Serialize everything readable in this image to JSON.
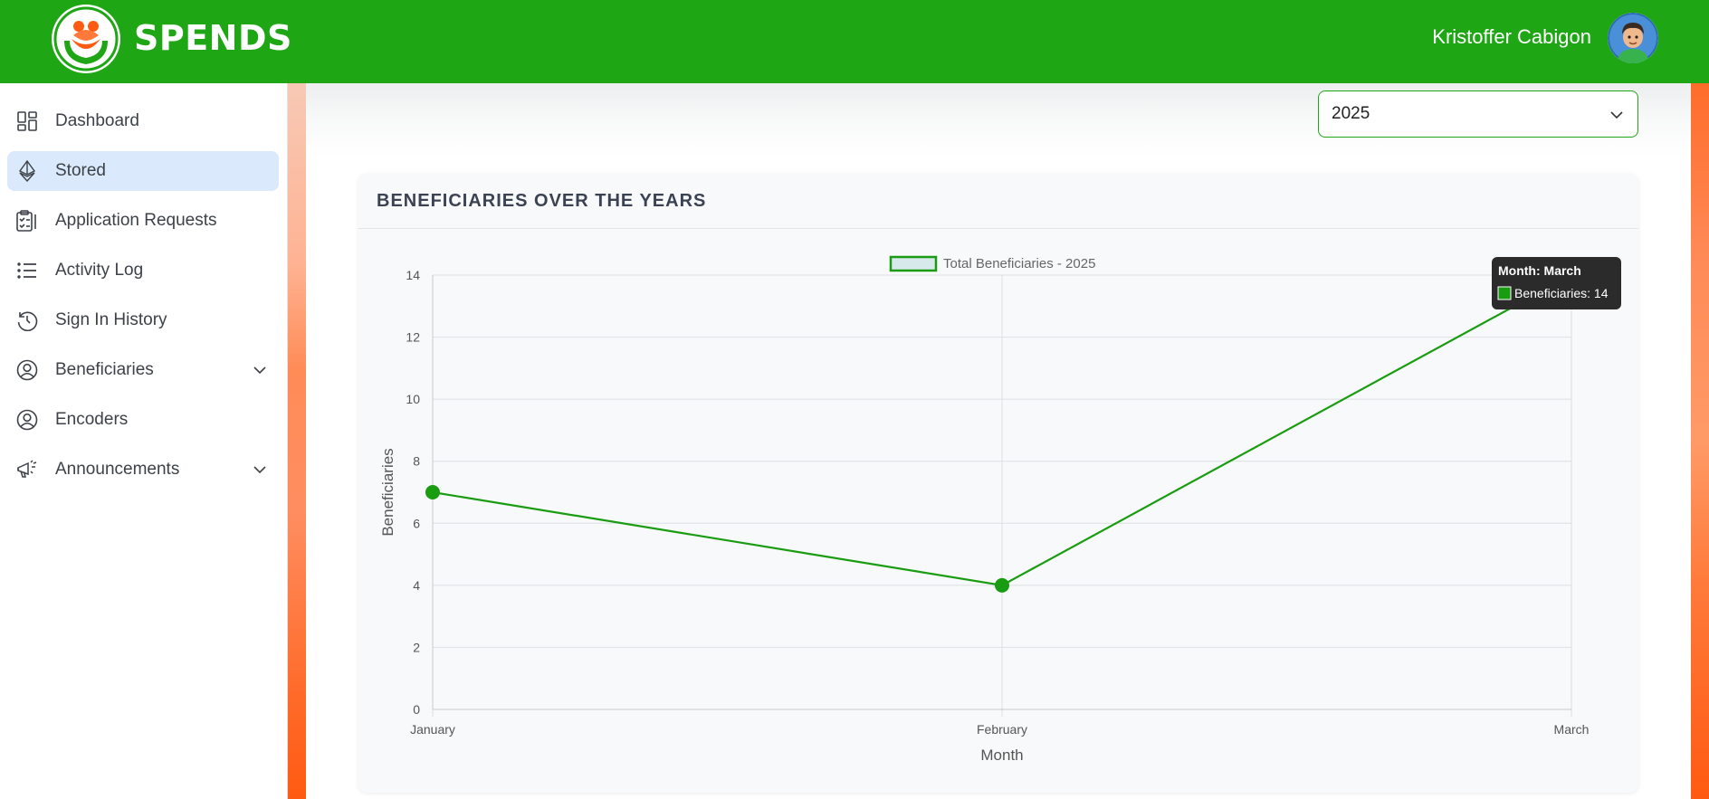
{
  "header": {
    "brand": "SPENDS",
    "user_name": "Kristoffer Cabigon"
  },
  "sidebar": {
    "items": [
      {
        "label": "Dashboard",
        "icon": "dashboard-grid-icon",
        "active": false
      },
      {
        "label": "Stored",
        "icon": "ethereum-icon",
        "active": true
      },
      {
        "label": "Application Requests",
        "icon": "clipboard-checklist-icon",
        "active": false
      },
      {
        "label": "Activity Log",
        "icon": "list-icon",
        "active": false
      },
      {
        "label": "Sign In History",
        "icon": "history-clock-icon",
        "active": false
      },
      {
        "label": "Beneficiaries",
        "icon": "user-circle-icon",
        "active": false,
        "has_submenu": true
      },
      {
        "label": "Encoders",
        "icon": "user-circle-icon",
        "active": false
      },
      {
        "label": "Announcements",
        "icon": "megaphone-icon",
        "active": false,
        "has_submenu": true
      }
    ]
  },
  "filter": {
    "year_selected": "2025"
  },
  "card": {
    "title": "BENEFICIARIES OVER THE YEARS"
  },
  "colors": {
    "brand_green": "#1ea614",
    "line_green": "#1a9c12",
    "active_nav_bg": "#dbe9fc",
    "orange_accent": "#ff6b2a"
  },
  "chart_data": {
    "type": "line",
    "categories": [
      "January",
      "February",
      "March"
    ],
    "series": [
      {
        "name": "Total Beneficiaries - 2025",
        "values": [
          7,
          4,
          14
        ]
      }
    ],
    "xlabel": "Month",
    "ylabel": "Beneficiaries",
    "ylim": [
      0,
      14
    ],
    "yticks": [
      0,
      2,
      4,
      6,
      8,
      10,
      12,
      14
    ],
    "grid": true,
    "legend_position": "top",
    "tooltip": {
      "title": "Month: March",
      "label": "Beneficiaries: 14"
    }
  }
}
